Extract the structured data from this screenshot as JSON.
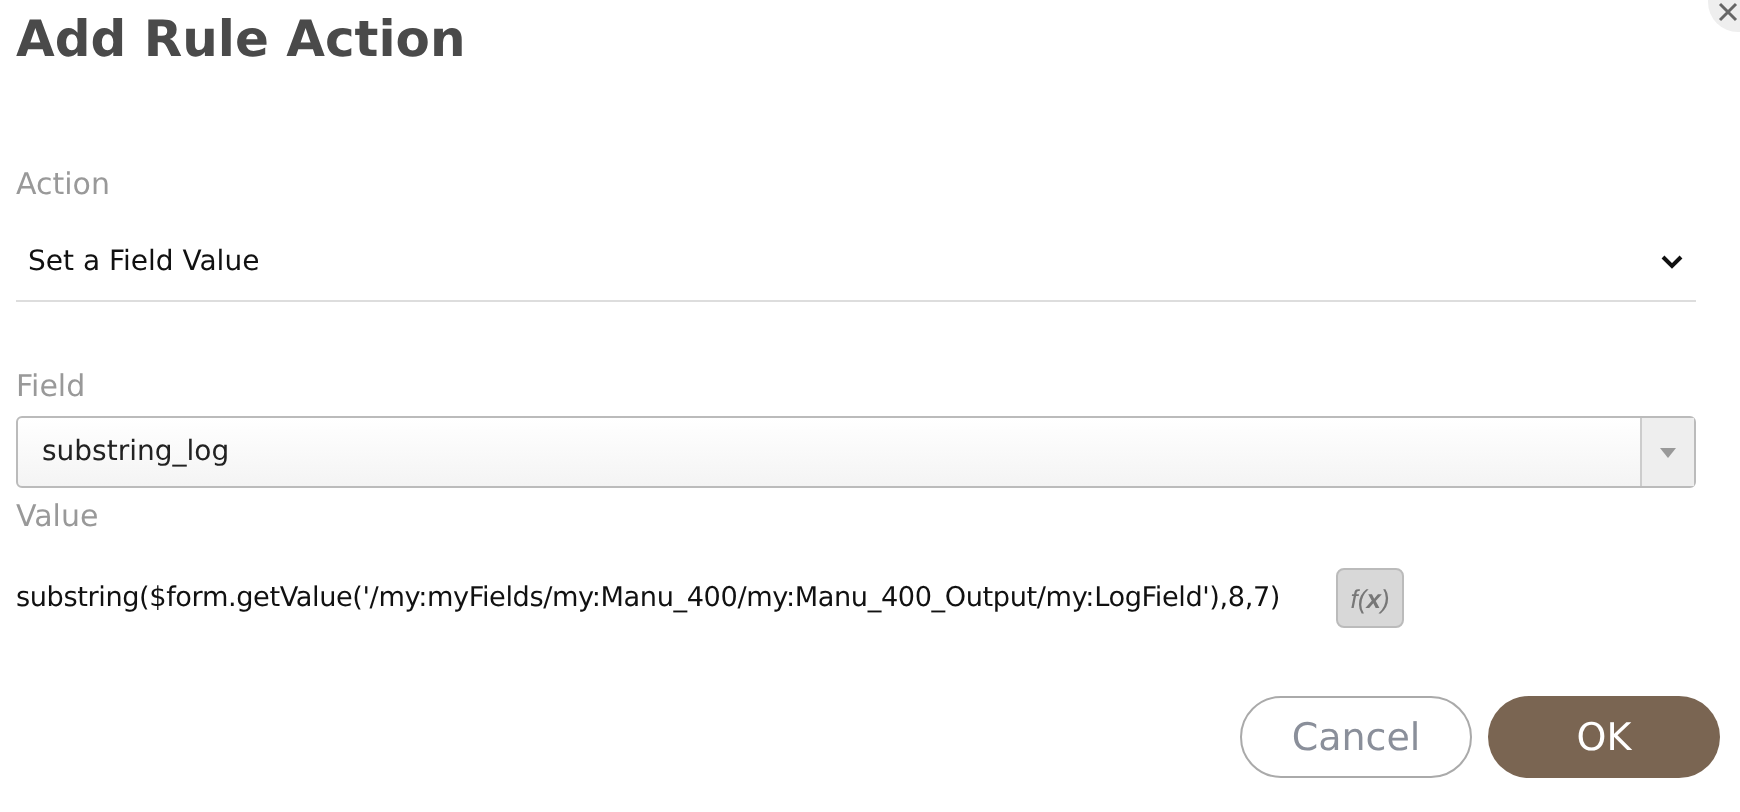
{
  "dialog": {
    "title": "Add Rule Action"
  },
  "action": {
    "label": "Action",
    "value": "Set a Field Value"
  },
  "field": {
    "label": "Field",
    "value": "substring_log"
  },
  "value": {
    "label": "Value",
    "text": "substring($form.getValue('/my:myFields/my:Manu_400/my:Manu_400_Output/my:LogField'),8,7)",
    "function_button": "f(**x**)"
  },
  "buttons": [
    {
      "label": "Cancel",
      "kind": "secondary"
    },
    {
      "label": "OK",
      "kind": "primary"
    }
  ]
}
